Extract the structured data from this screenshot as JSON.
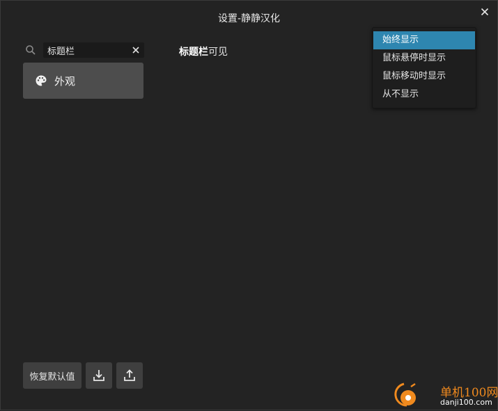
{
  "window": {
    "title": "设置-静静汉化"
  },
  "search": {
    "value": "标题栏"
  },
  "sidebar": {
    "items": [
      {
        "label": "外观",
        "icon": "palette-icon"
      }
    ]
  },
  "setting": {
    "label_bold": "标题栏",
    "label_rest": "可见"
  },
  "dropdown": {
    "options": [
      "始终显示",
      "鼠标悬停时显示",
      "鼠标移动时显示",
      "从不显示"
    ],
    "selected_index": 0
  },
  "footer": {
    "restore_label": "恢复默认值",
    "import_icon": "download-icon",
    "export_icon": "upload-icon"
  },
  "watermark": {
    "brand": "单机100网",
    "domain": "danji100.com"
  },
  "colors": {
    "background": "#232323",
    "accent": "#2e86b0",
    "nav_selected": "#4d4d4d",
    "brand": "#f08a1e"
  }
}
